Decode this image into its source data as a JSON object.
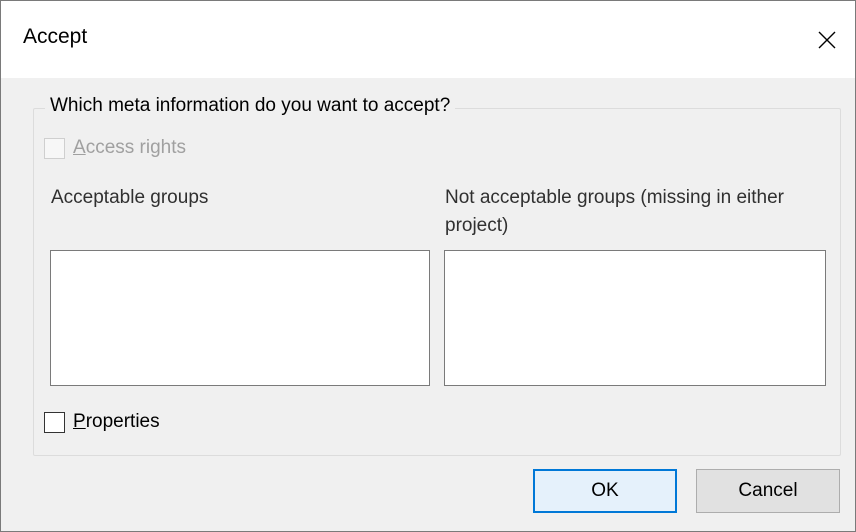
{
  "window": {
    "title": "Accept",
    "close_icon": "close-icon"
  },
  "group": {
    "legend": "Which meta information do you want to accept?",
    "access_rights": {
      "label": "Access rights",
      "checked": false,
      "enabled": false
    },
    "acceptable_groups": {
      "label": "Acceptable groups",
      "items": []
    },
    "not_acceptable_groups": {
      "label": "Not acceptable groups (missing in either project)",
      "items": []
    },
    "properties": {
      "label": "Properties",
      "checked": false,
      "enabled": true
    }
  },
  "buttons": {
    "ok": "OK",
    "cancel": "Cancel"
  },
  "colors": {
    "dialog_bg": "#f0f0f0",
    "default_button_border": "#0078d7"
  }
}
